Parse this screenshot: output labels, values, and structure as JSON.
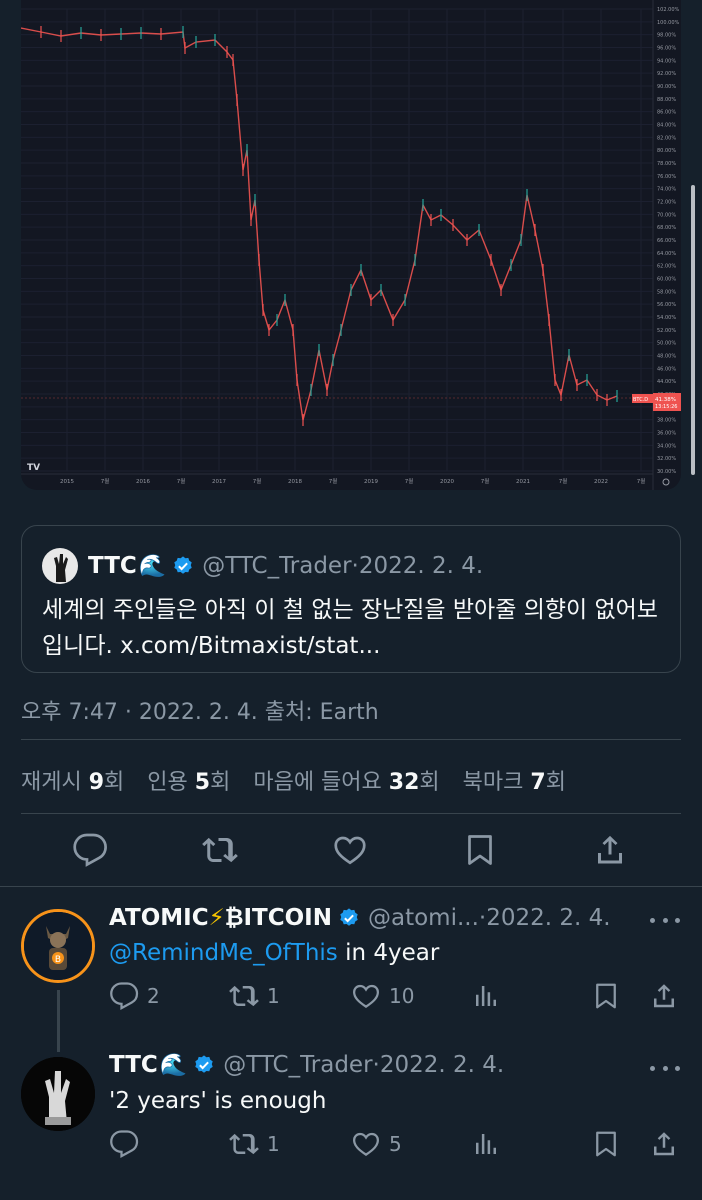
{
  "chart": {
    "y_ticks": [
      "102.00%",
      "100.00%",
      "98.00%",
      "96.00%",
      "94.00%",
      "92.00%",
      "90.00%",
      "88.00%",
      "86.00%",
      "84.00%",
      "82.00%",
      "80.00%",
      "78.00%",
      "76.00%",
      "74.00%",
      "72.00%",
      "70.00%",
      "68.00%",
      "66.00%",
      "64.00%",
      "62.00%",
      "60.00%",
      "58.00%",
      "56.00%",
      "54.00%",
      "52.00%",
      "50.00%",
      "48.00%",
      "46.00%",
      "44.00%",
      "42.00%",
      "40.00%",
      "38.00%",
      "36.00%",
      "34.00%",
      "32.00%",
      "30.00%"
    ],
    "x_ticks": [
      "2015",
      "7월",
      "2016",
      "7월",
      "2017",
      "7월",
      "2018",
      "7월",
      "2019",
      "7월",
      "2020",
      "7월",
      "2021",
      "7월",
      "2022",
      "7월"
    ],
    "series_label": "BTC.D",
    "last_value": "41.38%",
    "timer": "13:15:26",
    "logo": "TV",
    "up_color": "#26a69a",
    "down_color": "#ef5350",
    "bg_color": "#131722"
  },
  "quote": {
    "name": "TTC",
    "wave": "🌊",
    "handle": "@TTC_Trader",
    "dot": " · ",
    "date": "2022. 2. 4.",
    "text": "세계의 주인들은 아직 이 철 없는 장난질을 받아줄 의향이 없어보입니다. x.com/Bitmaxist/stat..."
  },
  "meta": "오후 7:47 · 2022. 2. 4. 출처: Earth",
  "stats": {
    "retweets_label": "재게시",
    "retweets": "9",
    "retweets_unit": "회",
    "quotes_label": "인용",
    "quotes": "5",
    "quotes_unit": "회",
    "likes_label": "마음에 들어요",
    "likes": "32",
    "likes_unit": "회",
    "bookmarks_label": "북마크",
    "bookmarks": "7",
    "bookmarks_unit": "회"
  },
  "replies": [
    {
      "name_part1": "ATOMIC",
      "bolt": "⚡",
      "name_part2": "₿ITCOIN",
      "handle": "@atomi...",
      "dot": " · ",
      "date": "2022. 2. 4.",
      "mention": "@RemindMe_OfThis",
      "text": " in 4year",
      "replies": "2",
      "retweets": "1",
      "likes": "10"
    },
    {
      "name": "TTC",
      "wave": "🌊",
      "handle": "@TTC_Trader",
      "dot": " · ",
      "date": "2022. 2. 4.",
      "text": "'2 years' is enough",
      "replies": "",
      "retweets": "1",
      "likes": "5"
    }
  ]
}
